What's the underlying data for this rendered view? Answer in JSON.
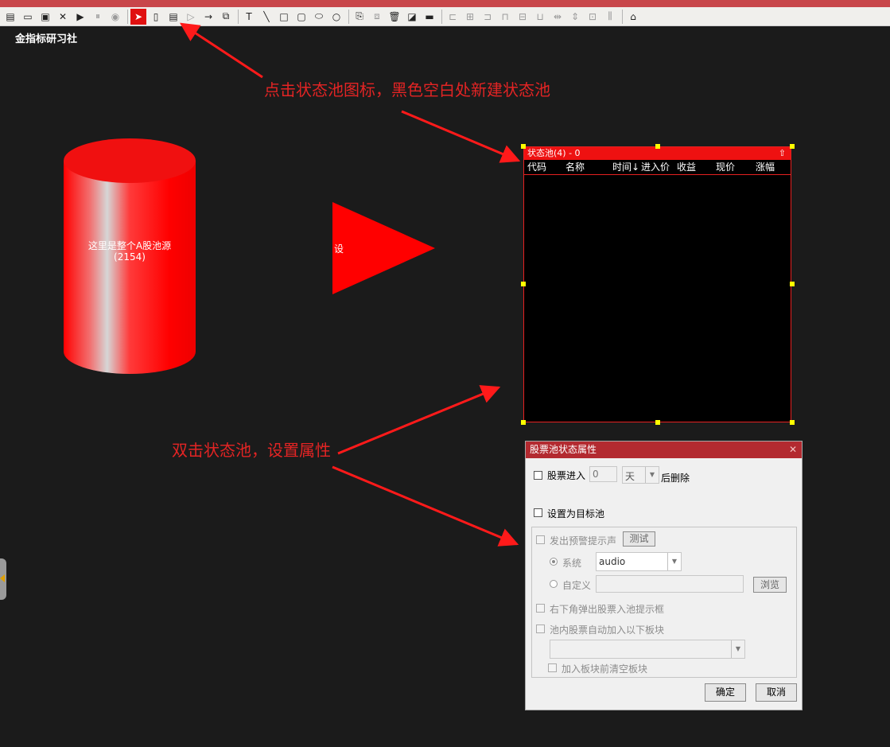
{
  "brand": "金指标研习社",
  "toolbar": {
    "icons": [
      "new-file-icon",
      "open-folder-icon",
      "save-icon",
      "close-x-icon",
      "play-icon",
      "pause-icon",
      "stop-icon",
      "pointer-icon",
      "cylinder-icon",
      "state-pool-icon",
      "triangle-icon",
      "arrow-icon",
      "copy-window-icon",
      "text-icon",
      "line-icon",
      "rectangle-icon",
      "rounded-rect-icon",
      "ellipse-icon",
      "circle-icon",
      "paste-icon",
      "duplicate-icon",
      "delete-icon",
      "fill-icon",
      "stroke-icon",
      "align-left-icon",
      "align-center-icon",
      "align-right-icon",
      "align-top-icon",
      "align-middle-icon",
      "align-bottom-icon",
      "same-width-icon",
      "same-height-icon",
      "same-size-icon",
      "distribute-icon",
      "network-icon"
    ],
    "active": "pointer-icon"
  },
  "canvas": {
    "cylinder": {
      "line1": "这里是整个A股池源",
      "line2": "(2154)"
    },
    "triangle": {
      "label": "设"
    }
  },
  "annotations": {
    "note1": "点击状态池图标，黑色空白处新建状态池",
    "note2": "双击状态池，设置属性"
  },
  "state_pool": {
    "title": "状态池(4) - 0",
    "collapse_glyph": "⇧",
    "columns": [
      "代码",
      "名称",
      "时间↓",
      "进入价",
      "收益",
      "现价",
      "涨幅"
    ]
  },
  "dialog": {
    "title": "股票池状态属性",
    "close_glyph": "✕",
    "stock_enter_label": "股票进入",
    "days_value": "0",
    "unit_value": "天",
    "delete_after_label": "后删除",
    "target_pool_label": "设置为目标池",
    "alert_sound_label": "发出预警提示声",
    "test_button": "测试",
    "system_label": "系统",
    "system_value": "audio",
    "custom_label": "自定义",
    "custom_value": "",
    "browse_button": "浏览",
    "popup_label": "右下角弹出股票入池提示框",
    "auto_add_label": "池内股票自动加入以下板块",
    "block_value": "",
    "clear_before_label": "加入板块前清空板块",
    "ok_button": "确定",
    "cancel_button": "取消"
  },
  "colors": {
    "accent_red": "#e32424",
    "pool_title_red": "#ee1111",
    "dialog_title": "#b32a30",
    "canvas_bg": "#1b1b1b"
  }
}
